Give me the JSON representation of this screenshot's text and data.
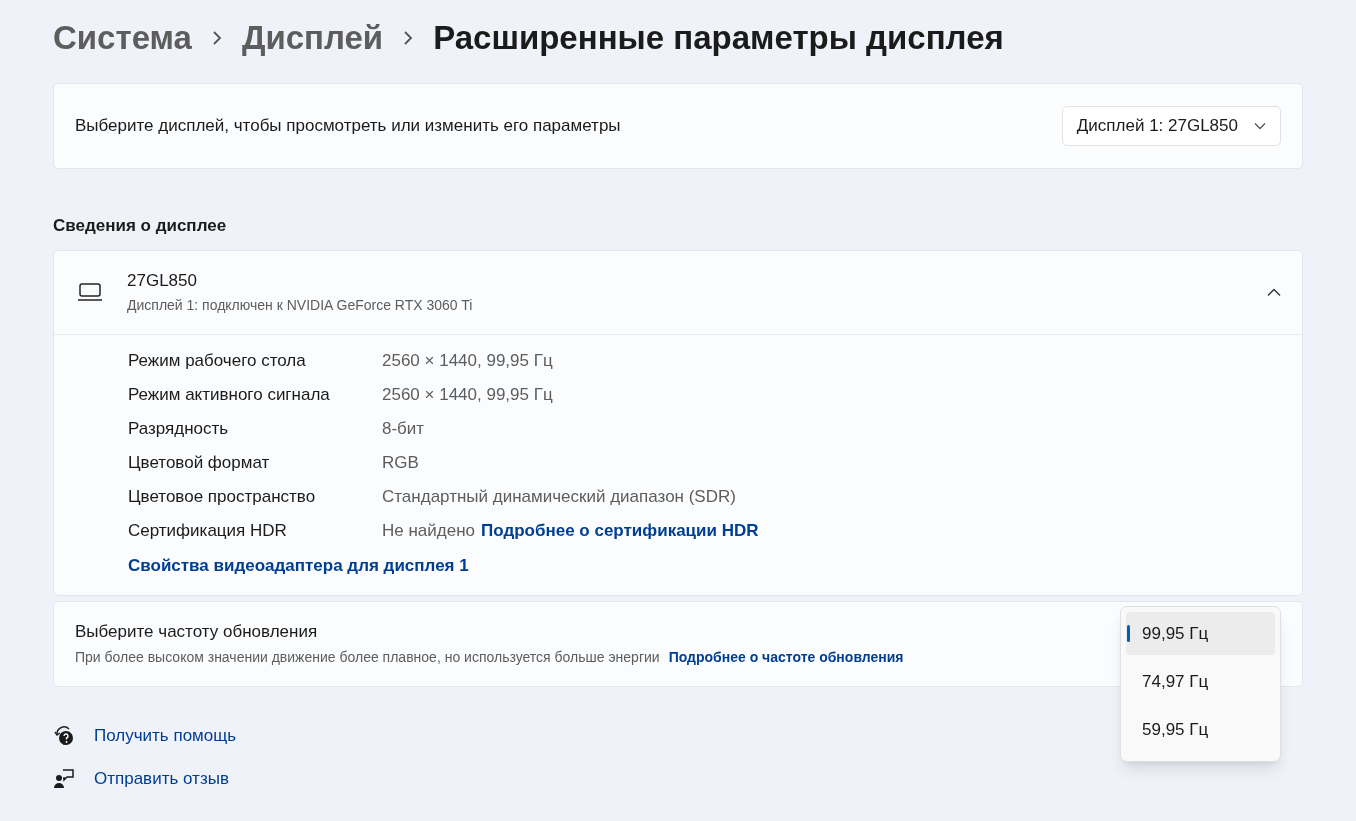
{
  "breadcrumb": [
    "Система",
    "Дисплей",
    "Расширенные параметры дисплея"
  ],
  "display_select": {
    "label": "Выберите дисплей, чтобы просмотреть или изменить его параметры",
    "value": "Дисплей 1: 27GL850"
  },
  "section_title": "Сведения о дисплее",
  "display_info": {
    "name": "27GL850",
    "subtitle": "Дисплей 1: подключен к NVIDIA GeForce RTX 3060 Ti",
    "expanded": true,
    "rows": [
      {
        "label": "Режим рабочего стола",
        "value": "2560 × 1440, 99,95 Гц"
      },
      {
        "label": "Режим активного сигнала",
        "value": "2560 × 1440, 99,95 Гц"
      },
      {
        "label": "Разрядность",
        "value": "8-бит"
      },
      {
        "label": "Цветовой формат",
        "value": "RGB"
      },
      {
        "label": "Цветовое пространство",
        "value": "Стандартный динамический диапазон (SDR)"
      },
      {
        "label": "Сертификация HDR",
        "value": "Не найдено",
        "link": "Подробнее о сертификации HDR"
      }
    ],
    "adapter_link": "Свойства видеоадаптера для дисплея 1"
  },
  "refresh_rate": {
    "title": "Выберите частоту обновления",
    "description": "При более высоком значении движение более плавное, но используется больше энергии",
    "link": "Подробнее о частоте обновления",
    "options": [
      {
        "label": "99,95 Гц",
        "selected": true
      },
      {
        "label": "74,97 Гц",
        "selected": false
      },
      {
        "label": "59,95 Гц",
        "selected": false
      }
    ]
  },
  "footer_links": [
    {
      "kind": "help",
      "label": "Получить помощь"
    },
    {
      "kind": "feedback",
      "label": "Отправить отзыв"
    }
  ]
}
